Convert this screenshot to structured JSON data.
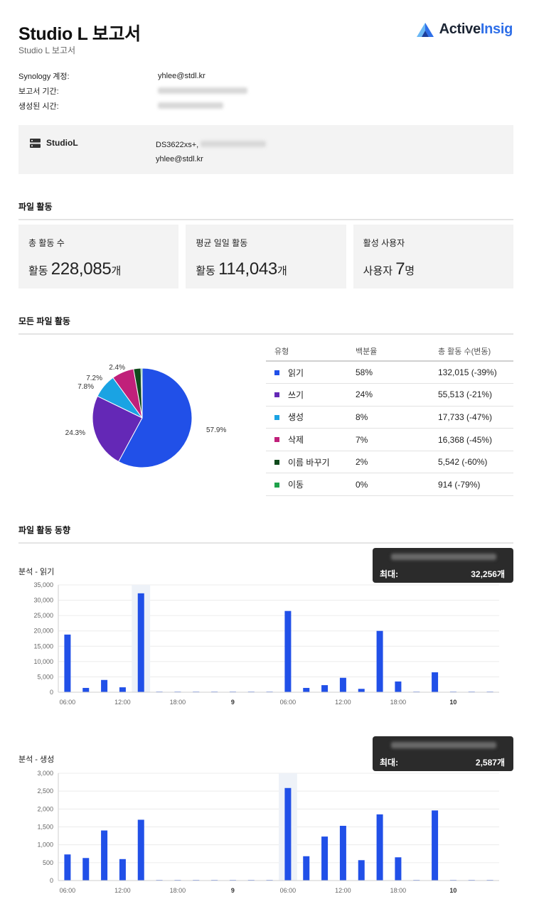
{
  "header": {
    "title": "Studio L 보고서",
    "subtitle": "Studio L 보고서",
    "logo_text_a": "Active",
    "logo_text_b": "Insig"
  },
  "meta": {
    "account_label": "Synology 계정:",
    "account_value": "yhlee@stdl.kr",
    "period_label": "보고서 기간:",
    "created_label": "생성된 시간:"
  },
  "server": {
    "name": "StudioL",
    "model": "DS3622xs+,",
    "email": "yhlee@stdl.kr"
  },
  "file_activity": {
    "heading": "파일 활동",
    "cards": [
      {
        "label": "총 활동 수",
        "prefix": "활동 ",
        "value": "228,085",
        "suffix": "개"
      },
      {
        "label": "평균 일일 활동",
        "prefix": "활동 ",
        "value": "114,043",
        "suffix": "개"
      },
      {
        "label": "활성 사용자",
        "prefix": "사용자 ",
        "value": "7",
        "suffix": "명"
      }
    ]
  },
  "all_activity": {
    "heading": "모든 파일 활동",
    "columns": [
      "유형",
      "백분율",
      "총 활동 수(변동)"
    ],
    "rows": [
      {
        "type": "읽기",
        "pct": "58%",
        "total": "132,015 (-39%)",
        "color": "#2150e8"
      },
      {
        "type": "쓰기",
        "pct": "24%",
        "total": "55,513 (-21%)",
        "color": "#6428b6"
      },
      {
        "type": "생성",
        "pct": "8%",
        "total": "17,733 (-47%)",
        "color": "#1aa3e3"
      },
      {
        "type": "삭제",
        "pct": "7%",
        "total": "16,368 (-45%)",
        "color": "#c0207a"
      },
      {
        "type": "이름 바꾸기",
        "pct": "2%",
        "total": "5,542 (-60%)",
        "color": "#0f4a1c"
      },
      {
        "type": "이동",
        "pct": "0%",
        "total": "914 (-79%)",
        "color": "#1fa24a"
      }
    ],
    "pie_labels": [
      "57.9%",
      "24.3%",
      "7.8%",
      "7.2%",
      "2.4%"
    ],
    "pie_values": [
      57.9,
      24.3,
      7.8,
      7.2,
      2.4,
      0.4
    ]
  },
  "trend": {
    "heading": "파일 활동 동향",
    "max_label": "최대:"
  },
  "chart_data": [
    {
      "type": "bar",
      "title": "분석 - 읽기",
      "x_ticks": [
        "06:00",
        "12:00",
        "18:00",
        "9",
        "06:00",
        "12:00",
        "18:00",
        "10"
      ],
      "y_ticks": [
        "0",
        "5,000",
        "10,000",
        "15,000",
        "20,000",
        "25,000",
        "30,000",
        "35,000"
      ],
      "ylim": [
        0,
        35000
      ],
      "values": [
        18800,
        1400,
        4000,
        1600,
        32256,
        30,
        30,
        30,
        30,
        30,
        30,
        30,
        26500,
        1400,
        2300,
        4700,
        1100,
        20000,
        3500,
        30,
        6500,
        30,
        30,
        30
      ],
      "highlight_index": 4,
      "tooltip_max": "32,256개",
      "color": "#2150e8"
    },
    {
      "type": "bar",
      "title": "분석 - 생성",
      "x_ticks": [
        "06:00",
        "12:00",
        "18:00",
        "9",
        "06:00",
        "12:00",
        "18:00",
        "10"
      ],
      "y_ticks": [
        "0",
        "500",
        "1,000",
        "1,500",
        "2,000",
        "2,500",
        "3,000"
      ],
      "ylim": [
        0,
        3000
      ],
      "values": [
        730,
        630,
        1400,
        600,
        1700,
        5,
        5,
        5,
        5,
        5,
        5,
        5,
        2587,
        680,
        1230,
        1530,
        570,
        1850,
        650,
        5,
        1960,
        5,
        5,
        5
      ],
      "highlight_index": 12,
      "tooltip_max": "2,587개",
      "color": "#2150e8"
    }
  ]
}
